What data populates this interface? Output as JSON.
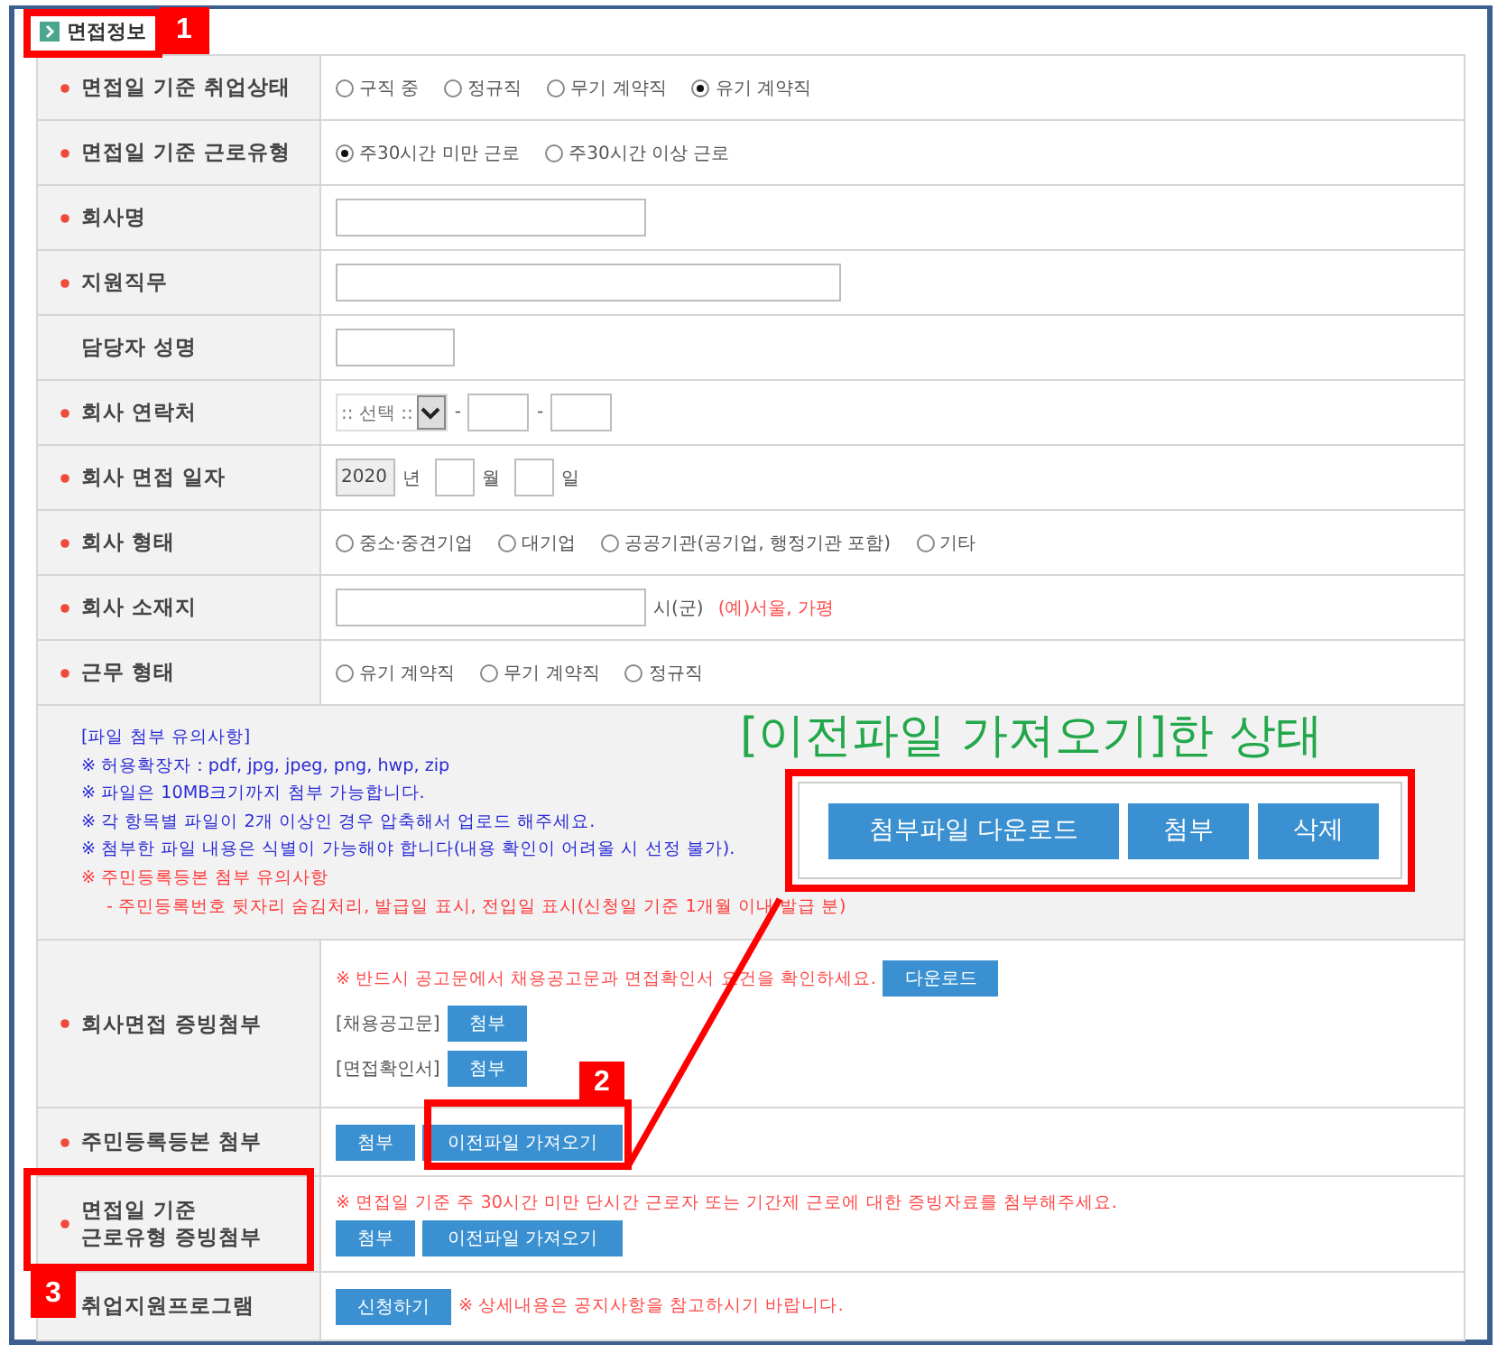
{
  "section": {
    "title": "면접정보"
  },
  "rows": [
    {
      "kind": "radio",
      "label": "면접일 기준 취업상태",
      "required": true,
      "options": [
        {
          "label": "구직 중",
          "selected": false
        },
        {
          "label": "정규직",
          "selected": false
        },
        {
          "label": "무기 계약직",
          "selected": false
        },
        {
          "label": "유기 계약직",
          "selected": true
        }
      ]
    },
    {
      "kind": "radio",
      "label": "면접일 기준 근로유형",
      "required": true,
      "options": [
        {
          "label": "주30시간 미만 근로",
          "selected": true
        },
        {
          "label": "주30시간 이상 근로",
          "selected": false
        }
      ]
    },
    {
      "kind": "field",
      "label": "회사명",
      "required": true
    },
    {
      "kind": "widefield",
      "label": "지원직무",
      "required": true
    },
    {
      "kind": "smallfield",
      "label": "담당자 성명",
      "required": false
    },
    {
      "kind": "phone",
      "label": "회사 연락처",
      "required": true,
      "select": ":: 선택 ::",
      "separators": [
        "-",
        "-"
      ]
    },
    {
      "kind": "date",
      "label": "회사 면접 일자",
      "required": true,
      "year": "2020",
      "units": [
        "년",
        "월",
        "일"
      ]
    },
    {
      "kind": "radio",
      "label": "회사 형태",
      "required": true,
      "options": [
        {
          "label": "중소·중견기업",
          "selected": false
        },
        {
          "label": "대기업",
          "selected": false
        },
        {
          "label": "공공기관(공기업, 행정기관 포함)",
          "selected": false
        },
        {
          "label": "기타",
          "selected": false
        }
      ]
    },
    {
      "kind": "address",
      "label": "회사 소재지",
      "required": true,
      "suffix": "시(군)",
      "hint": "(예)서울, 가평"
    },
    {
      "kind": "radio",
      "label": "근무 형태",
      "required": true,
      "options": [
        {
          "label": "유기 계약직",
          "selected": false
        },
        {
          "label": "무기 계약직",
          "selected": false
        },
        {
          "label": "정규직",
          "selected": false
        }
      ]
    },
    {
      "kind": "notes",
      "lines": [
        {
          "text": "[파일 첨부 유의사항]",
          "color": "#2b2bd6"
        },
        {
          "text": "※ 허용확장자 : pdf, jpg, jpeg, png, hwp, zip",
          "color": "#2b2bd6"
        },
        {
          "text": "※ 파일은 10MB크기까지 첨부 가능합니다.",
          "color": "#2b2bd6"
        },
        {
          "text": "※ 각 항목별 파일이 2개 이상인 경우 압축해서 업로드 해주세요.",
          "color": "#2b2bd6"
        },
        {
          "text": "※ 첨부한 파일 내용은 식별이 가능해야 합니다(내용 확인이 어려울 시 선정 불가).",
          "color": "#2b2bd6"
        },
        {
          "text": "※ 주민등록등본 첨부 유의사항",
          "color": "#ff3b3b"
        },
        {
          "text": "- 주민등록번호 뒷자리 숨김처리, 발급일 표시, 전입일 표시(신청일 기준 1개월 이내 발급 분)",
          "color": "#ff3b3b"
        }
      ]
    },
    {
      "kind": "attach",
      "label": "회사면접 증빙첨부",
      "required": true,
      "notice": "※ 반드시 공고문에서 채용공고문과 면접확인서 요건을 확인하세요.",
      "notice_button": "다운로드",
      "items": [
        {
          "label": "[채용공고문]",
          "button": "첨부"
        },
        {
          "label": "[면접확인서]",
          "button": "첨부"
        }
      ]
    },
    {
      "kind": "buttons",
      "label": "주민등록등본 첨부",
      "required": true,
      "buttons": [
        "첨부",
        "이전파일 가져오기"
      ]
    },
    {
      "kind": "buttons",
      "label": "면접일 기준\n근로유형 증빙첨부",
      "required": true,
      "notice": "※ 면접일 기준 주 30시간 미만 단시간 근로자 또는 기간제 근로에 대한 증빙자료를 첨부해주세요.",
      "buttons": [
        "첨부",
        "이전파일 가져오기"
      ]
    },
    {
      "kind": "program",
      "label": "취업지원프로그램",
      "required": false,
      "button": "신청하기",
      "notice": "※ 상세내용은 공지사항을 참고하시기 바랍니다."
    }
  ],
  "annotations": {
    "badges": [
      "1",
      "2",
      "3"
    ],
    "caption": "[이전파일 가져오기]한 상태",
    "callout_buttons": [
      "첨부파일 다운로드",
      "첨부",
      "삭제"
    ]
  }
}
